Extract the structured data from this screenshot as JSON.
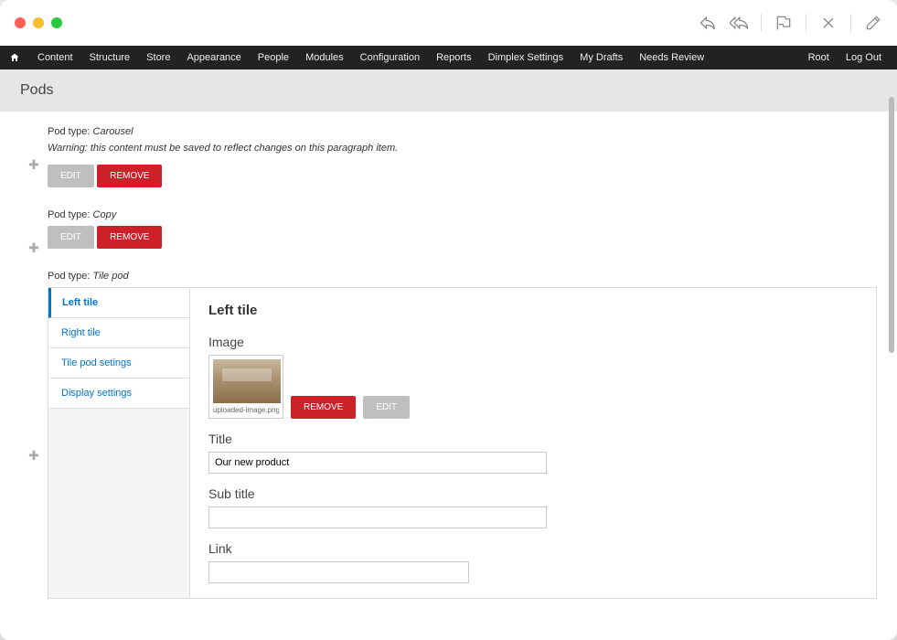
{
  "adminMenu": {
    "items": [
      "Content",
      "Structure",
      "Store",
      "Appearance",
      "People",
      "Modules",
      "Configuration",
      "Reports",
      "Dimplex Settings",
      "My Drafts",
      "Needs Review"
    ],
    "rightItems": [
      "Root",
      "Log Out"
    ]
  },
  "page": {
    "title": "Pods"
  },
  "labels": {
    "podTypeLabel": "Pod type:",
    "edit": "EDIT",
    "remove": "REMOVE"
  },
  "pods": [
    {
      "type": "Carousel",
      "warning": "Warning: this content must be saved to reflect changes on this paragraph item."
    },
    {
      "type": "Copy"
    },
    {
      "type": "Tile pod"
    }
  ],
  "tileEditor": {
    "tabs": [
      "Left tile",
      "Right tile",
      "Tile pod setings",
      "Display settings"
    ],
    "activeTab": "Left tile",
    "heading": "Left tile",
    "imageSection": {
      "label": "Image",
      "filename": "uploaded-image.png"
    },
    "titleSection": {
      "label": "Title",
      "value": "Our new product"
    },
    "subtitleSection": {
      "label": "Sub title",
      "value": ""
    },
    "linkSection": {
      "label": "Link",
      "value": ""
    }
  }
}
